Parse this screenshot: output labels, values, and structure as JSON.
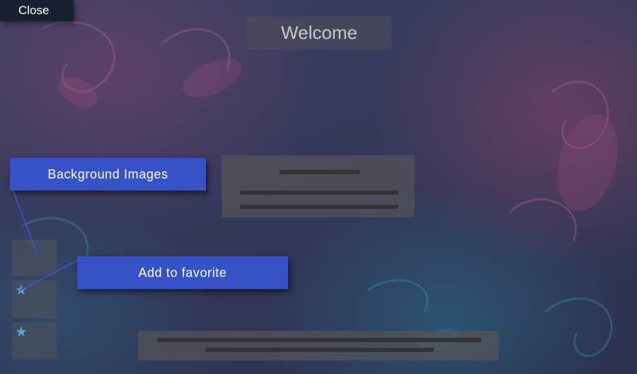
{
  "app": {
    "close_label": "Close",
    "welcome_title": "Welcome"
  },
  "callouts": {
    "background_images": "Background Images",
    "add_to_favorite": "Add to favorite"
  },
  "thumbnails": [
    {
      "favorite": false
    },
    {
      "favorite": true,
      "icon": "star-icon"
    },
    {
      "favorite": true,
      "icon": "star-icon"
    }
  ],
  "colors": {
    "callout_bg": "#3752c6",
    "star": "#5aa0d6",
    "close_bg": "#17202e"
  }
}
